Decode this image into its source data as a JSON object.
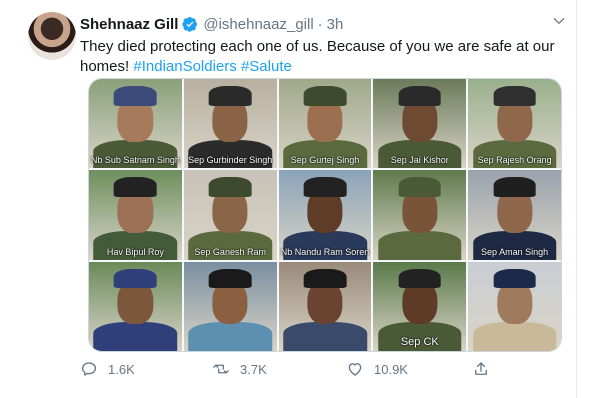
{
  "tweet": {
    "author_name": "Shehnaaz Gill",
    "handle": "@ishehnaaz_gill",
    "separator": "·",
    "time": "3h",
    "text_plain": "They died protecting each one of us. Because of you we are safe at our homes!",
    "hashtag_1": "#IndianSoldiers",
    "hashtag_2": "#Salute"
  },
  "photo_captions": [
    "Nb Sub Satnam Singh",
    "Sep Gurbinder Singh",
    "Sep Gurtej Singh",
    "Sep Jai Kishor",
    "Sep Rajesh Orang",
    "Hav Bipul Roy",
    "Sep Ganesh Ram",
    "Nb Nandu Ram Soren",
    "",
    "Sep Aman Singh",
    "",
    "",
    "",
    "Sep CK",
    ""
  ],
  "actions": {
    "reply_count": "1.6K",
    "retweet_count": "3.7K",
    "like_count": "10.9K"
  },
  "colors": {
    "link": "#1da1f2",
    "muted": "#657786"
  }
}
